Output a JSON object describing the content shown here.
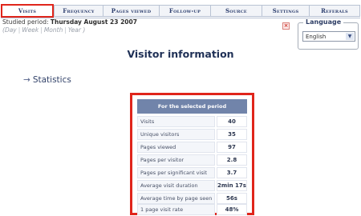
{
  "tabs": [
    {
      "label": "Visits",
      "active": true
    },
    {
      "label": "Frequency",
      "active": false
    },
    {
      "label": "Pages viewed",
      "active": false
    },
    {
      "label": "Follow-up",
      "active": false
    },
    {
      "label": "Source",
      "active": false
    },
    {
      "label": "Settings",
      "active": false
    },
    {
      "label": "Referals",
      "active": false
    }
  ],
  "period": {
    "prefix": "Studied period:",
    "value": "Thursday August 23 2007",
    "open": "(",
    "close": ")",
    "links": [
      "Day",
      "Week",
      "Month",
      "Year"
    ]
  },
  "language": {
    "legend": "Language",
    "selected": "English"
  },
  "page_title": "Visitor information",
  "statistics_link": "Statistics",
  "stats_table": {
    "header": "For the selected period",
    "rows": [
      {
        "label": "Visits",
        "value": "40"
      },
      {
        "label": "Unique visitors",
        "value": "35"
      },
      {
        "label": "Pages viewed",
        "value": "97"
      },
      {
        "label": "Pages per visitor",
        "value": "2.8"
      },
      {
        "label": "Pages per significant visit",
        "value": "3.7"
      },
      {
        "label": "Average visit duration",
        "value": "2min 17s"
      },
      {
        "label": "Average time by page seen",
        "value": "56s"
      },
      {
        "label": "1 page visit rate",
        "value": "48%"
      }
    ]
  },
  "colors": {
    "highlight": "#e0251b",
    "table_header": "#7184aa",
    "title": "#1f3056"
  },
  "icons": {
    "close": "close-icon",
    "dropdown": "chevron-down-icon",
    "statistics": "arrow-right-icon"
  }
}
